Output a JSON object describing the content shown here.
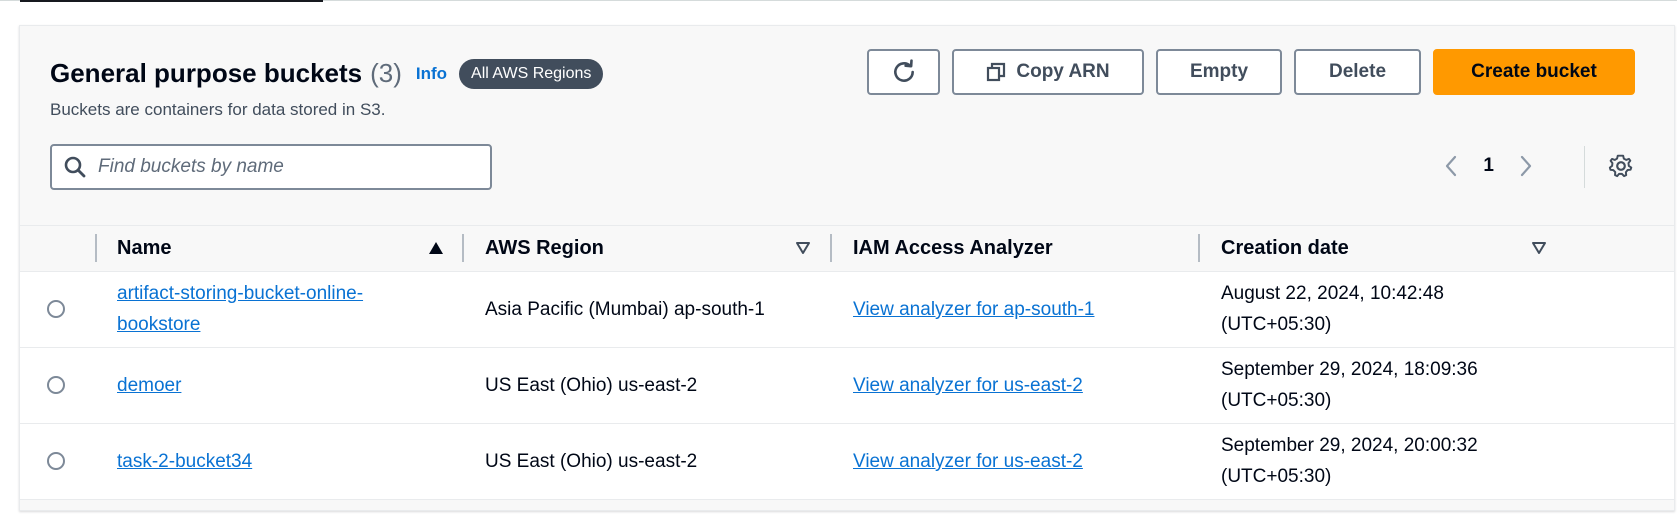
{
  "header": {
    "title": "General purpose buckets",
    "count": "(3)",
    "info": "Info",
    "region_badge": "All AWS Regions",
    "subtitle": "Buckets are containers for data stored in S3."
  },
  "toolbar": {
    "refresh_icon": "refresh-icon",
    "copy_arn": "Copy ARN",
    "empty": "Empty",
    "delete": "Delete",
    "create": "Create bucket"
  },
  "search": {
    "placeholder": "Find buckets by name",
    "value": ""
  },
  "pagination": {
    "current_page": "1"
  },
  "table": {
    "columns": [
      "Name",
      "AWS Region",
      "IAM Access Analyzer",
      "Creation date"
    ],
    "sorted_column": "Name",
    "rows": [
      {
        "name_line1": "artifact-storing-bucket-online-",
        "name_line2": "bookstore",
        "region": "Asia Pacific (Mumbai) ap-south-1",
        "analyzer": "View analyzer for ap-south-1",
        "date_line1": "August 22, 2024, 10:42:48",
        "date_line2": "(UTC+05:30)"
      },
      {
        "name_line1": "demoer",
        "region": "US East (Ohio) us-east-2",
        "analyzer": "View analyzer for us-east-2",
        "date_line1": "September 29, 2024, 18:09:36",
        "date_line2": "(UTC+05:30)"
      },
      {
        "name_line1": "task-2-bucket34",
        "region": "US East (Ohio) us-east-2",
        "analyzer": "View analyzer for us-east-2",
        "date_line1": "September 29, 2024, 20:00:32",
        "date_line2": "(UTC+05:30)"
      }
    ]
  },
  "colors": {
    "primary": "#ff9900",
    "link": "#0972d3",
    "badge": "#414d5c"
  }
}
